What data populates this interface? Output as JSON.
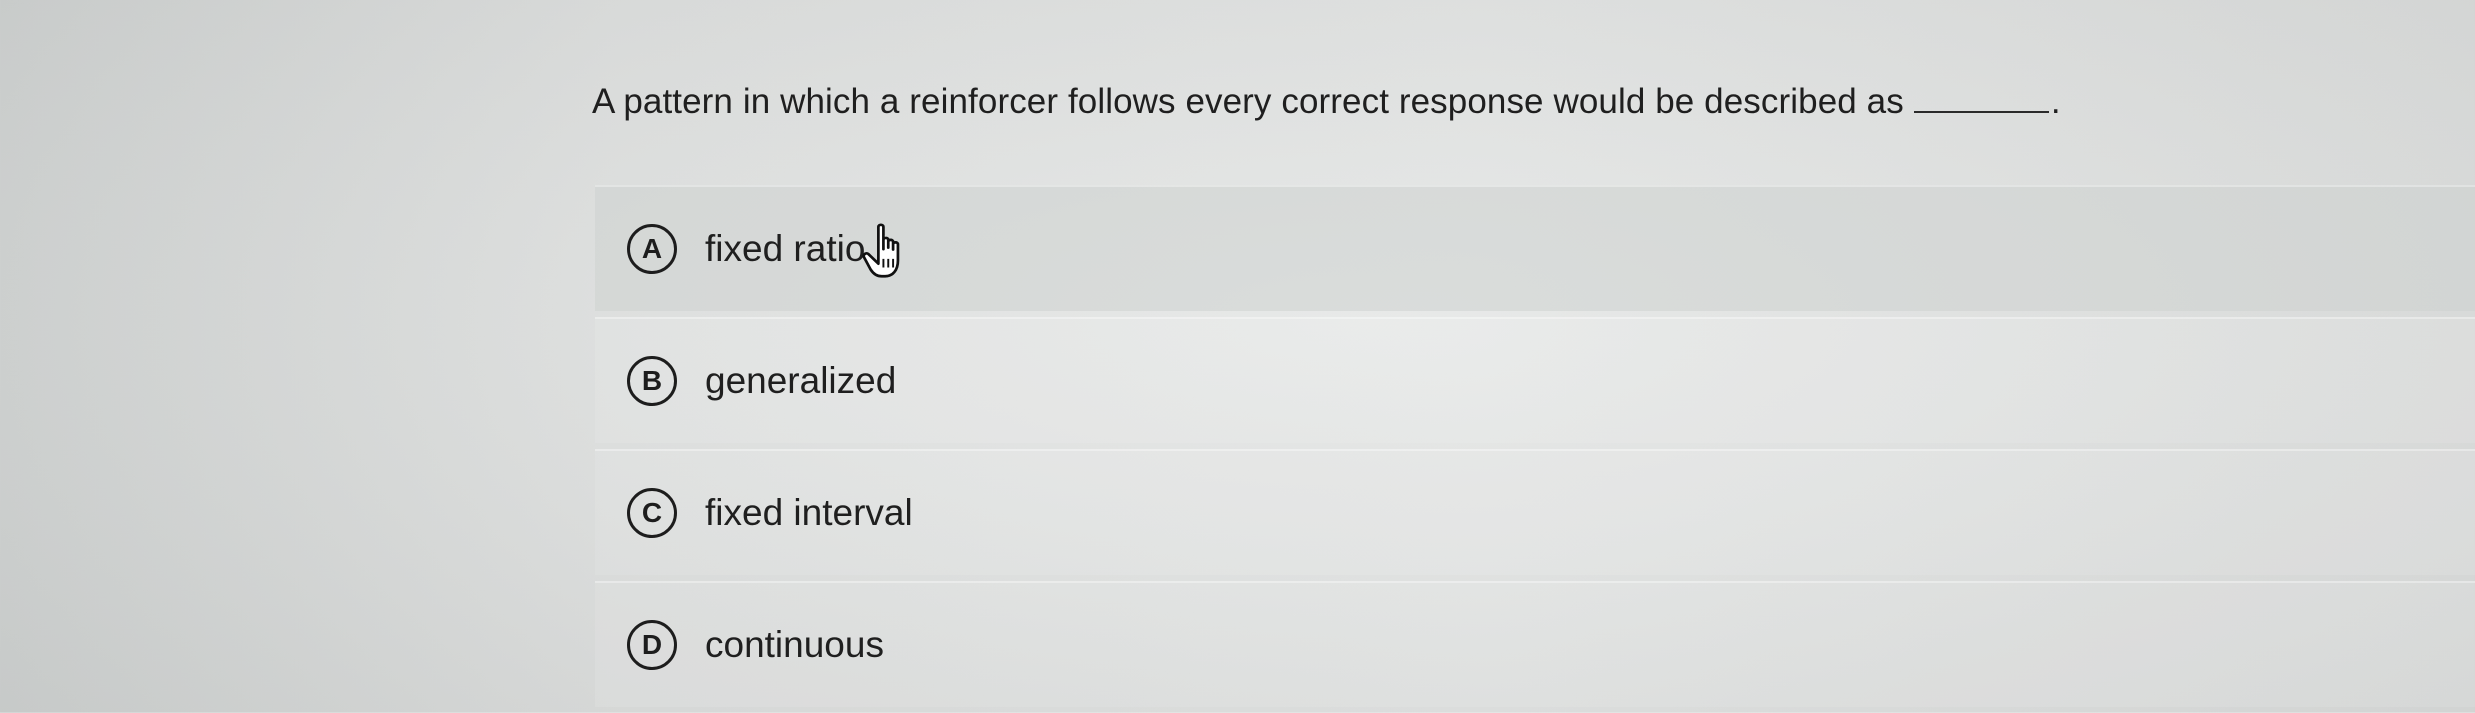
{
  "question": {
    "text": "A pattern in which a reinforcer follows every correct response would be described as",
    "end_mark": "."
  },
  "options": [
    {
      "letter": "A",
      "text": "fixed ratio"
    },
    {
      "letter": "B",
      "text": "generalized"
    },
    {
      "letter": "C",
      "text": "fixed interval"
    },
    {
      "letter": "D",
      "text": "continuous"
    }
  ],
  "pointer": {
    "icon": "hand-pointer-icon"
  }
}
